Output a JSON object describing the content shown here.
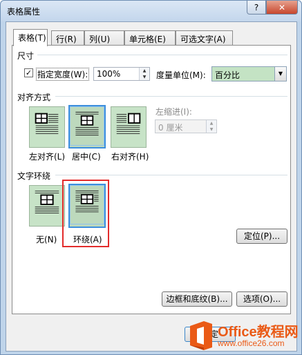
{
  "window": {
    "title": "表格属性",
    "help_label": "?",
    "close_label": "✕"
  },
  "tabs": [
    {
      "label": "表格(T)",
      "active": true
    },
    {
      "label": "行(R)",
      "active": false
    },
    {
      "label": "列(U)",
      "active": false
    },
    {
      "label": "单元格(E)",
      "active": false
    },
    {
      "label": "可选文字(A)",
      "active": false
    }
  ],
  "size": {
    "heading": "尺寸",
    "checkbox_checked": true,
    "check_mark": "✓",
    "width_label": "指定宽度(W):",
    "width_value": "100%",
    "unit_label": "度量单位(M):",
    "unit_value": "百分比"
  },
  "alignment": {
    "heading": "对齐方式",
    "options": [
      {
        "label": "左对齐(L)",
        "selected": false
      },
      {
        "label": "居中(C)",
        "selected": true
      },
      {
        "label": "右对齐(H)",
        "selected": false
      }
    ],
    "indent_label": "左缩进(I):",
    "indent_value": "0 厘米"
  },
  "wrapping": {
    "heading": "文字环绕",
    "options": [
      {
        "label": "无(N)",
        "selected": false
      },
      {
        "label": "环绕(A)",
        "selected": true
      }
    ],
    "position_button": "定位(P)..."
  },
  "buttons": {
    "borders": "边框和底纹(B)...",
    "options": "选项(O)...",
    "ok": "确定"
  },
  "watermark": {
    "brand": "Office教程网",
    "url": "www.office26.com"
  },
  "colors": {
    "option_fill": "#c7e3c7",
    "selected_border": "#3d8fdc",
    "highlight_red": "#e32b2b",
    "combo_fill": "#c4e3c4"
  }
}
